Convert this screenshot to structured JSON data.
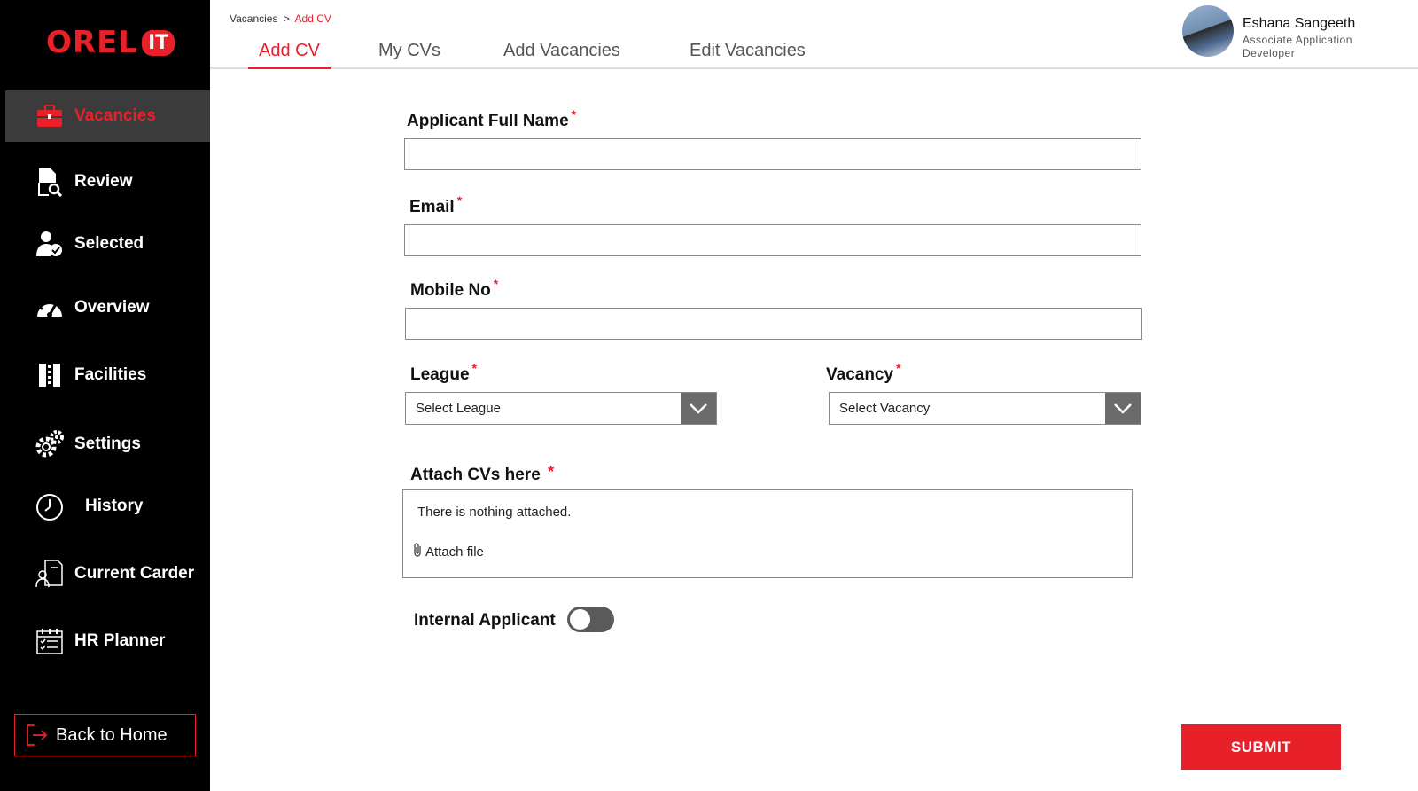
{
  "brand": {
    "name": "OREL",
    "badge": "IT",
    "accent": "#e8202a"
  },
  "sidebar": {
    "items": [
      {
        "label": "Vacancies",
        "icon": "briefcase-icon",
        "active": true
      },
      {
        "label": "Review",
        "icon": "document-search-icon"
      },
      {
        "label": "Selected",
        "icon": "user-check-icon"
      },
      {
        "label": "Overview",
        "icon": "speedometer-icon"
      },
      {
        "label": "Facilities",
        "icon": "facilities-icon"
      },
      {
        "label": "Settings",
        "icon": "gears-icon"
      },
      {
        "label": "History",
        "icon": "clock-icon"
      },
      {
        "label": "Current Carder",
        "icon": "user-document-icon"
      },
      {
        "label": "HR Planner",
        "icon": "calendar-icon"
      }
    ],
    "back_home": "Back to Home"
  },
  "breadcrumb": {
    "parent": "Vacancies",
    "separator": ">",
    "current": "Add CV"
  },
  "tabs": [
    {
      "label": "Add CV",
      "active": true
    },
    {
      "label": "My CVs"
    },
    {
      "label": "Add Vacancies"
    },
    {
      "label": "Edit Vacancies"
    }
  ],
  "user": {
    "name": "Eshana Sangeeth",
    "role": "Associate Application Developer"
  },
  "form": {
    "full_name": {
      "label": "Applicant Full Name",
      "required": "*",
      "value": ""
    },
    "email": {
      "label": "Email",
      "required": "*",
      "value": ""
    },
    "mobile": {
      "label": "Mobile No",
      "required": "*",
      "value": ""
    },
    "league": {
      "label": "League",
      "required": "*",
      "selected": "Select League"
    },
    "vacancy": {
      "label": "Vacancy",
      "required": "*",
      "selected": "Select Vacancy"
    },
    "attach": {
      "label": "Attach CVs here",
      "required": "*",
      "empty_message": "There is nothing attached.",
      "link": "Attach file"
    },
    "internal": {
      "label": "Internal Applicant",
      "on": false
    },
    "submit": "SUBMIT"
  }
}
